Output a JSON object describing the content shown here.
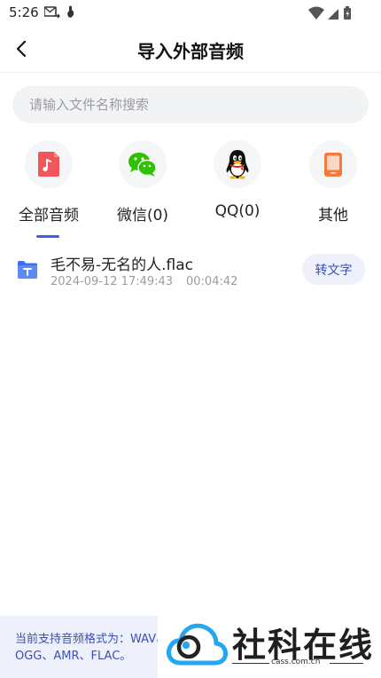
{
  "status_bar": {
    "time": "5:26"
  },
  "header": {
    "title": "导入外部音频"
  },
  "search": {
    "placeholder": "请输入文件名称搜索"
  },
  "categories": [
    {
      "label": "全部音频",
      "icon": "music-file-icon",
      "selected": true
    },
    {
      "label": "微信(0)",
      "icon": "wechat-icon",
      "selected": false
    },
    {
      "label": "QQ(0)",
      "icon": "qq-penguin-icon",
      "selected": false
    },
    {
      "label": "其他",
      "icon": "phone-icon",
      "selected": false
    }
  ],
  "files": [
    {
      "name": "毛不易-无名的人.flac",
      "date": "2024-09-12 17:49:43",
      "duration": "00:04:42",
      "action_label": "转文字",
      "icon": "audio-file-icon"
    }
  ],
  "footer": {
    "formats_text": "当前支持音频格式为：WAV、MP3、OGG、AMR、FLAC。"
  },
  "watermark": {
    "title": "社科在线",
    "url": "cass.com.cn"
  },
  "colors": {
    "accent": "#3d5bf0",
    "button_bg": "#eef1fb",
    "button_text": "#3a4fb8",
    "music_icon": "#f2555a",
    "wechat": "#2dc100",
    "phone_icon": "#f47b3a",
    "file_icon": "#3d6ff0",
    "watermark_blue": "#22a7f0"
  }
}
